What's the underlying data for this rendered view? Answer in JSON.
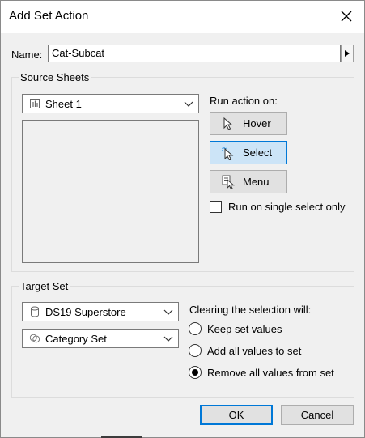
{
  "dialog": {
    "title": "Add Set Action",
    "close_icon": "close-icon"
  },
  "name": {
    "label": "Name:",
    "value": "Cat-Subcat",
    "arrow_icon": "triangle-right-icon"
  },
  "source_sheets": {
    "group_label": "Source Sheets",
    "sheet_dropdown": {
      "icon": "sheet-icon",
      "value": "Sheet 1"
    },
    "sheet_list": []
  },
  "run_action": {
    "label": "Run action on:",
    "buttons": [
      {
        "label": "Hover",
        "icon": "hover-cursor-icon",
        "selected": false
      },
      {
        "label": "Select",
        "icon": "select-cursor-icon",
        "selected": true
      },
      {
        "label": "Menu",
        "icon": "menu-cursor-icon",
        "selected": false
      }
    ],
    "single_select": {
      "label": "Run on single select only",
      "checked": false
    }
  },
  "target_set": {
    "group_label": "Target Set",
    "datasource_dropdown": {
      "icon": "database-icon",
      "value": "DS19 Superstore"
    },
    "set_dropdown": {
      "icon": "set-icon",
      "value": "Category Set"
    },
    "clearing_label": "Clearing the selection will:",
    "options": [
      {
        "label": "Keep set values",
        "checked": false
      },
      {
        "label": "Add all values to set",
        "checked": false
      },
      {
        "label": "Remove all values from set",
        "checked": true
      }
    ]
  },
  "footer": {
    "ok_label": "OK",
    "cancel_label": "Cancel"
  },
  "colors": {
    "dialog_bg": "#f0f0f0",
    "title_bg": "#ffffff",
    "accent": "#0078d7",
    "selected_btn_bg": "#cce4f7"
  }
}
